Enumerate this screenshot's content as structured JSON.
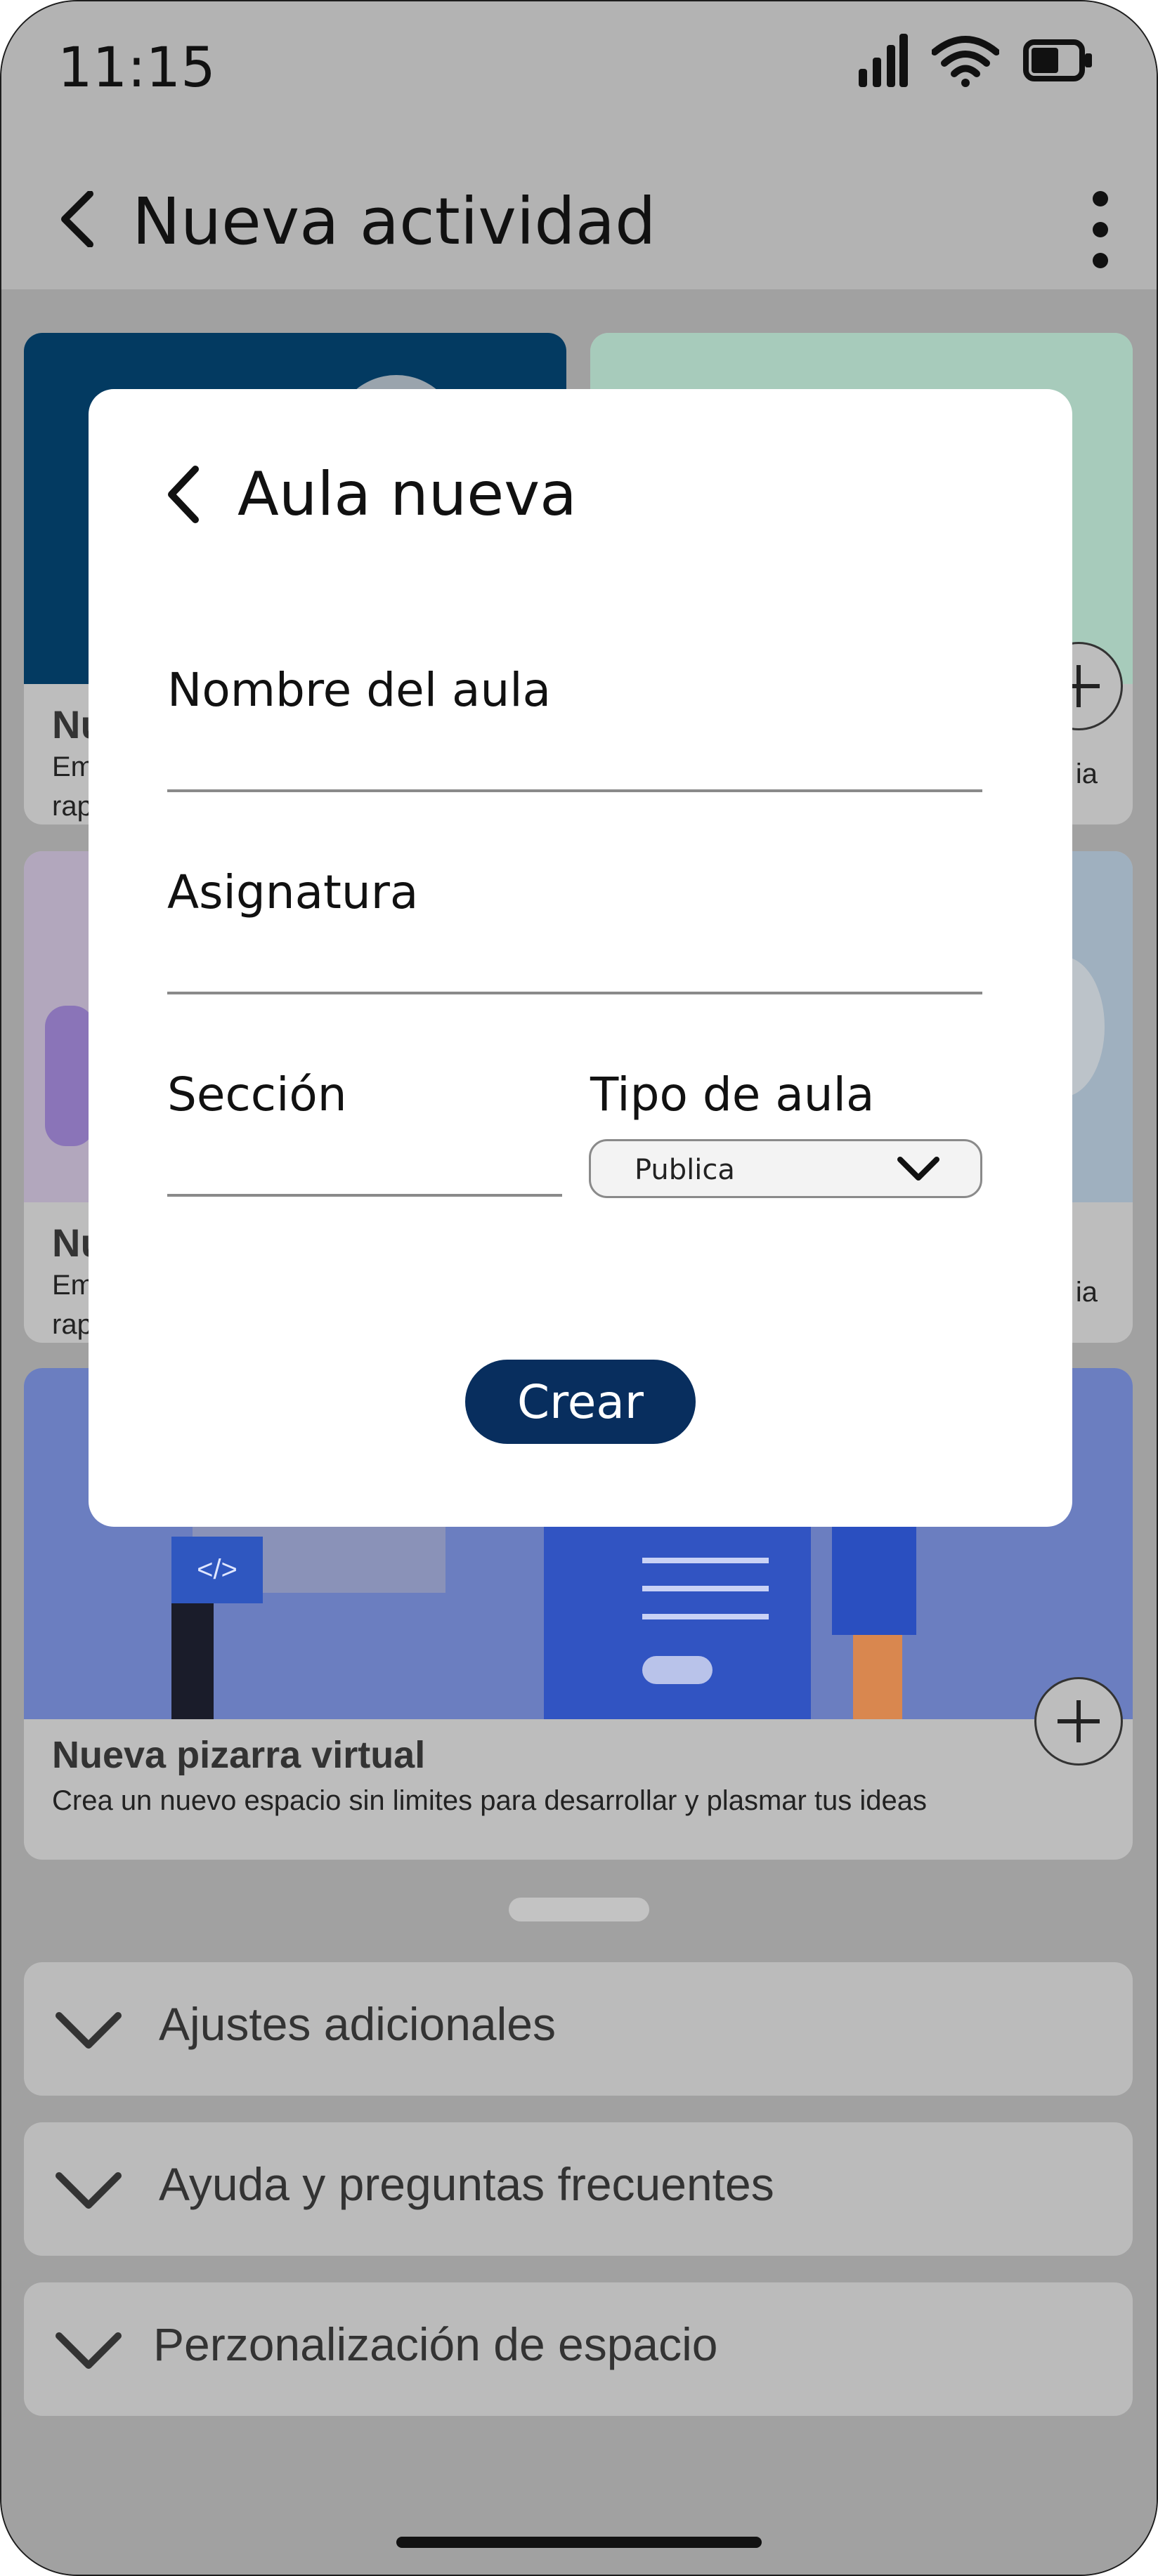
{
  "status_bar": {
    "time": "11:15"
  },
  "app_bar": {
    "title": "Nueva actividad"
  },
  "cards": {
    "card1": {
      "title": "Nu",
      "desc_line1": "Em",
      "desc_line2": "rap"
    },
    "card2": {
      "desc_fragment": "ia"
    },
    "card3": {
      "title": "Nu",
      "desc_line1": "Em",
      "desc_line2": "rap"
    },
    "card4": {
      "desc_fragment": "ia"
    },
    "whiteboard": {
      "title": "Nueva pizarra virtual",
      "desc": "Crea un nuevo espacio sin limites para desarrollar y plasmar tus ideas",
      "code_tag": "</>"
    }
  },
  "accordions": [
    {
      "label": "Ajustes adicionales"
    },
    {
      "label": "Ayuda y preguntas frecuentes"
    },
    {
      "label": "Perzonalización de espacio"
    }
  ],
  "modal": {
    "title": "Aula nueva",
    "fields": {
      "classroom_name_label": "Nombre del aula",
      "subject_label": "Asignatura",
      "section_label": "Sección",
      "classroom_type_label": "Tipo de aula",
      "classroom_type_value": "Publica"
    },
    "create_label": "Crear"
  },
  "colors": {
    "primary": "#082e5e",
    "scrim": "#a1a1a1",
    "card": "#bdbdbd",
    "modal_bg": "#ffffff"
  }
}
